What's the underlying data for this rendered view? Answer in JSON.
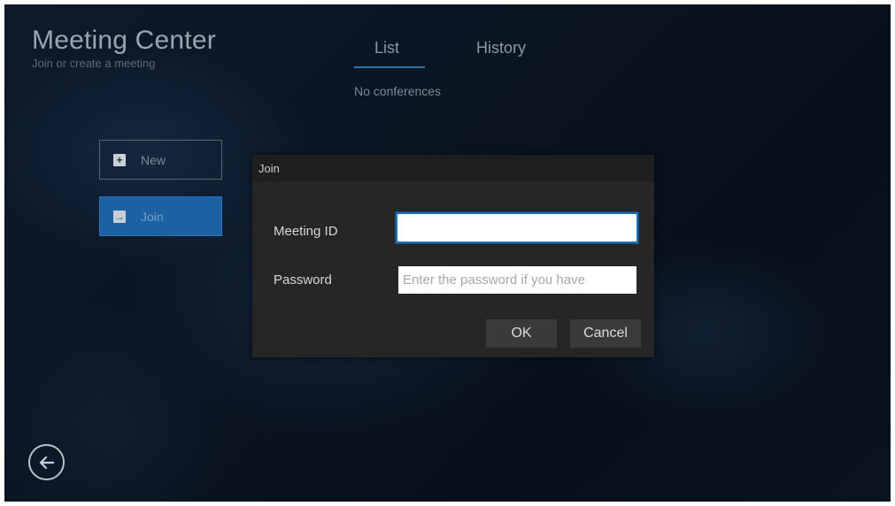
{
  "app": {
    "title": "Meeting Center",
    "subtitle": "Join or create a meeting"
  },
  "tabs": {
    "list_label": "List",
    "history_label": "History",
    "active": "List"
  },
  "list": {
    "empty_text": "No conferences"
  },
  "sidebar": {
    "new_label": "New",
    "join_label": "Join",
    "new_icon": "plus-icon",
    "join_icon": "join-arrow-icon",
    "selected": "Join"
  },
  "dialog": {
    "title": "Join",
    "meeting_id_label": "Meeting ID",
    "meeting_id_value": "",
    "password_label": "Password",
    "password_placeholder": "Enter the password if you have",
    "ok_label": "OK",
    "cancel_label": "Cancel"
  },
  "footer": {
    "back_icon": "back-arrow-icon"
  },
  "colors": {
    "accent": "#1c62a3",
    "focus_border": "#1f6fb5",
    "dialog_bg": "#262626"
  }
}
